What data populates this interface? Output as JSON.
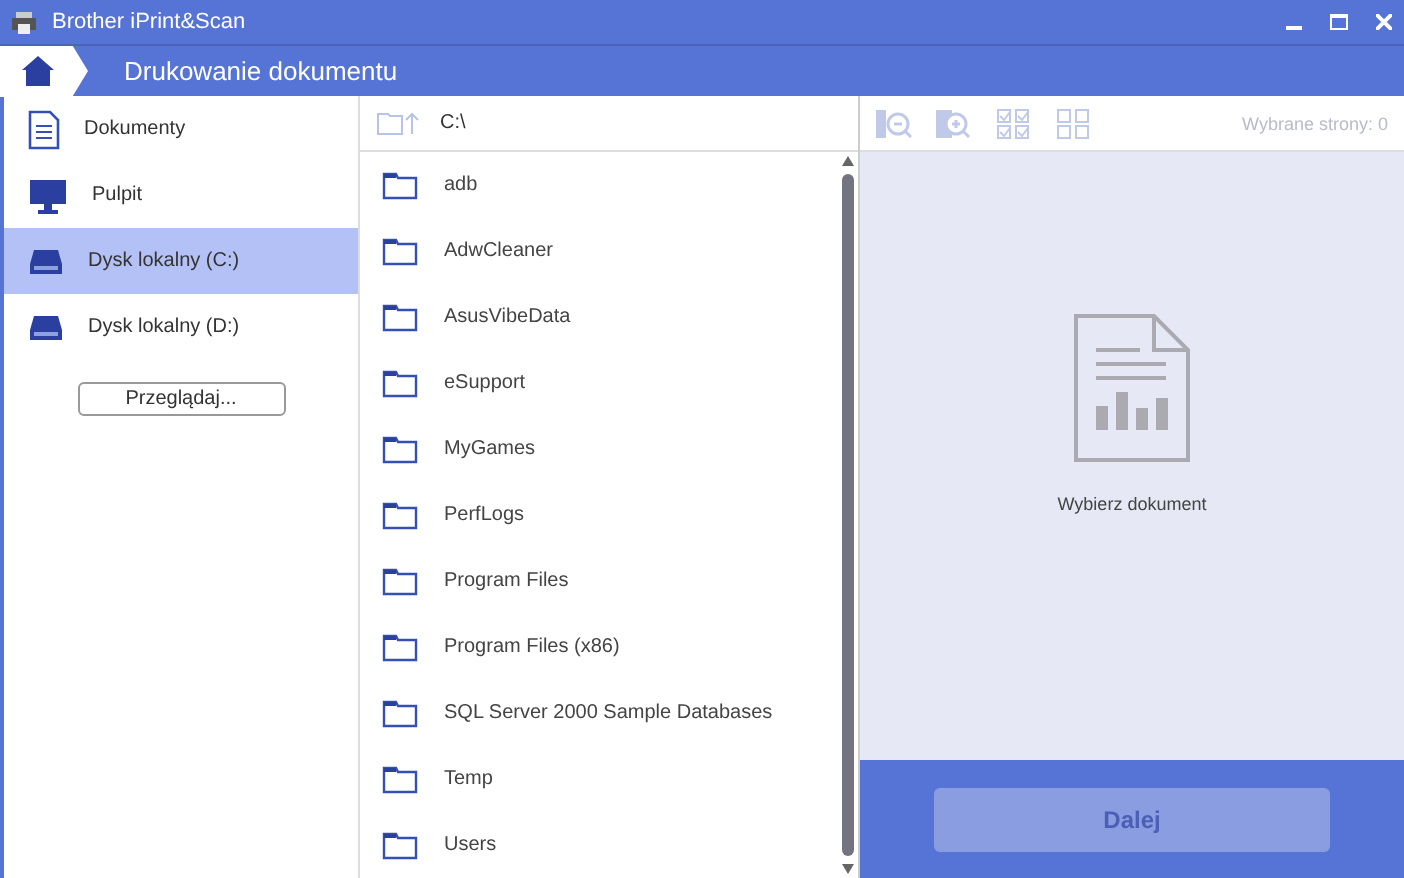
{
  "window": {
    "title": "Brother iPrint&Scan"
  },
  "header": {
    "title": "Drukowanie dokumentu"
  },
  "sidebar": {
    "items": [
      {
        "label": "Dokumenty",
        "kind": "documents",
        "selected": false
      },
      {
        "label": "Pulpit",
        "kind": "desktop",
        "selected": false
      },
      {
        "label": "Dysk lokalny (C:)",
        "kind": "drive",
        "selected": true
      },
      {
        "label": "Dysk lokalny (D:)",
        "kind": "drive",
        "selected": false
      }
    ],
    "browse_button": "Przeglądaj..."
  },
  "file_list": {
    "path": "C:\\",
    "folders": [
      "adb",
      "AdwCleaner",
      "AsusVibeData",
      "eSupport",
      "MyGames",
      "PerfLogs",
      "Program Files",
      "Program Files (x86)",
      "SQL Server 2000 Sample Databases",
      "Temp",
      "Users"
    ]
  },
  "preview": {
    "selected_pages": "Wybrane strony: 0",
    "toolbar_disabled": true,
    "empty_message": "Wybierz dokument"
  },
  "next_button": {
    "label": "Dalej",
    "disabled": true
  }
}
